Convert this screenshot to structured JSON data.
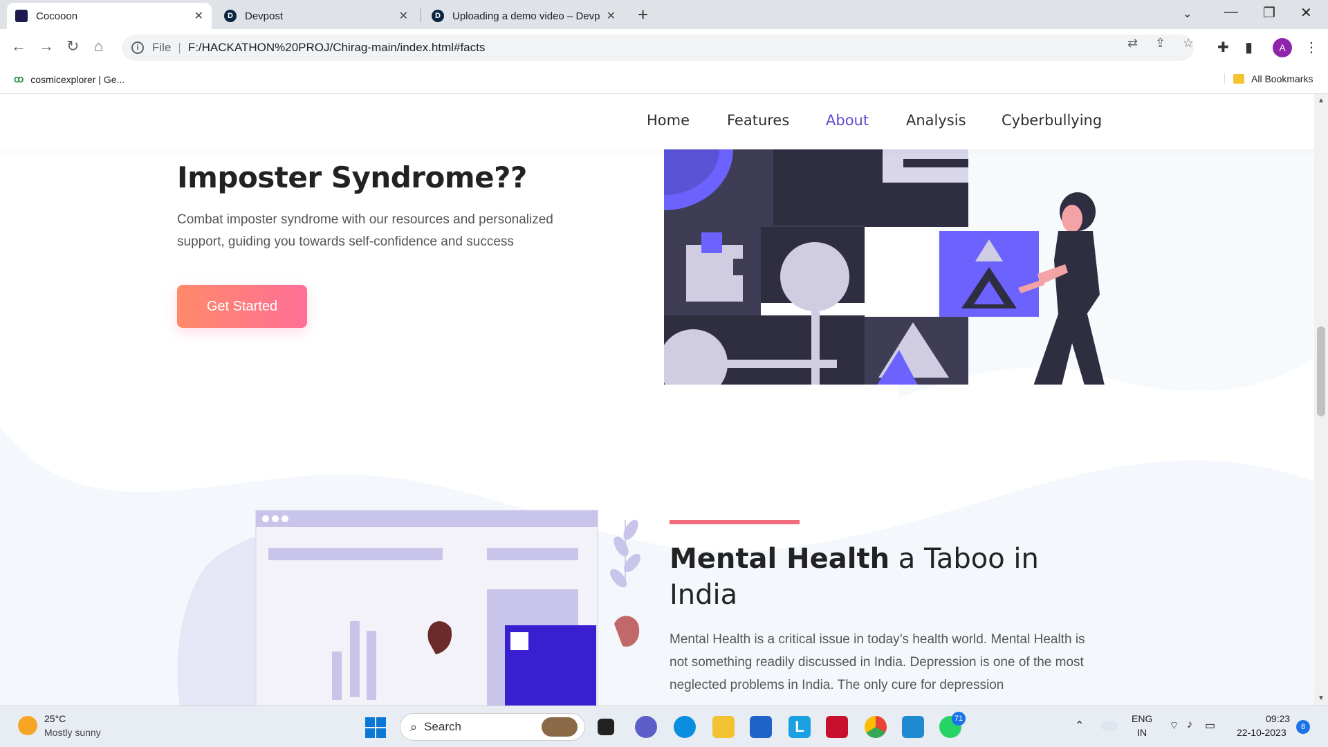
{
  "browser": {
    "tabs": [
      {
        "title": "Cocooon",
        "active": true
      },
      {
        "title": "Devpost",
        "active": false
      },
      {
        "title": "Uploading a demo video – Devp",
        "active": false
      }
    ],
    "address": {
      "scheme": "File",
      "url": "F:/HACKATHON%20PROJ/Chirag-main/index.html#facts"
    },
    "profile_initial": "A",
    "bookmarks": [
      {
        "label": "cosmicexplorer | Ge..."
      }
    ],
    "all_bookmarks_label": "All Bookmarks"
  },
  "site": {
    "nav": [
      "Home",
      "Features",
      "About",
      "Analysis",
      "Cyberbullying"
    ],
    "active_nav": "About",
    "imposter": {
      "heading": "Imposter Syndrome??",
      "body": "Combat imposter syndrome with our resources and personalized support, guiding you towards self-confidence and success",
      "cta": "Get Started"
    },
    "mental": {
      "heading_bold": "Mental Health",
      "heading_rest": " a Taboo in India",
      "body": "Mental Health is a critical issue in today’s health world. Mental Health is not something readily discussed in India. Depression is one of the most neglected problems in India. The only cure for depression"
    }
  },
  "taskbar": {
    "weather": {
      "temp": "25°C",
      "desc": "Mostly sunny"
    },
    "search_placeholder": "Search",
    "lang": {
      "line1": "ENG",
      "line2": "IN"
    },
    "clock": {
      "time": "09:23",
      "date": "22-10-2023"
    },
    "whatsapp_badge": "71",
    "notification_badge": "8"
  },
  "colors": {
    "accent_purple": "#6c63ff",
    "dark_illustration": "#2f2e41",
    "cta_gradient_start": "#fe8a6a",
    "cta_gradient_end": "#fe6f96",
    "accent_bar": "#f26b7a"
  }
}
